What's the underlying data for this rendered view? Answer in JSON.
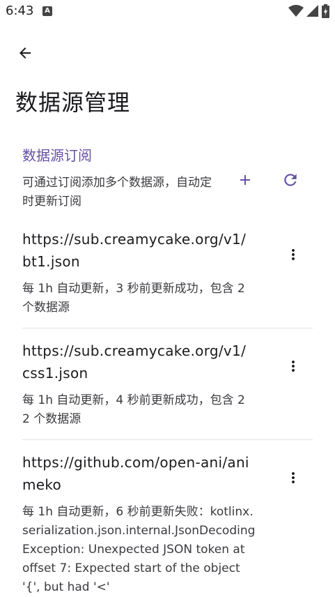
{
  "status_bar": {
    "time": "6:43",
    "notification": "A"
  },
  "page": {
    "title": "数据源管理"
  },
  "section": {
    "header": "数据源订阅",
    "description": "可通过订阅添加多个数据源，自动定时更新订阅"
  },
  "subscriptions": [
    {
      "url": "https://sub.creamycake.org/v1/bt1.json",
      "status": "每 1h 自动更新，3 秒前更新成功，包含 2 个数据源"
    },
    {
      "url": "https://sub.creamycake.org/v1/css1.json",
      "status": "每 1h 自动更新，4 秒前更新成功，包含 22 个数据源"
    },
    {
      "url": "https://github.com/open-ani/animeko",
      "status": "每 1h 自动更新，6 秒前更新失败：kotlinx.serialization.json.internal.JsonDecodingException: Unexpected JSON token at offset 7: Expected start of the object '{', but had '<'"
    }
  ],
  "icons": {
    "back": "back-arrow-icon",
    "add": "plus-icon",
    "refresh": "refresh-icon",
    "more": "more-vert-icon"
  },
  "colors": {
    "accent": "#6650a4",
    "text": "#1b1b1f",
    "secondary_text": "#3a3a3f"
  }
}
